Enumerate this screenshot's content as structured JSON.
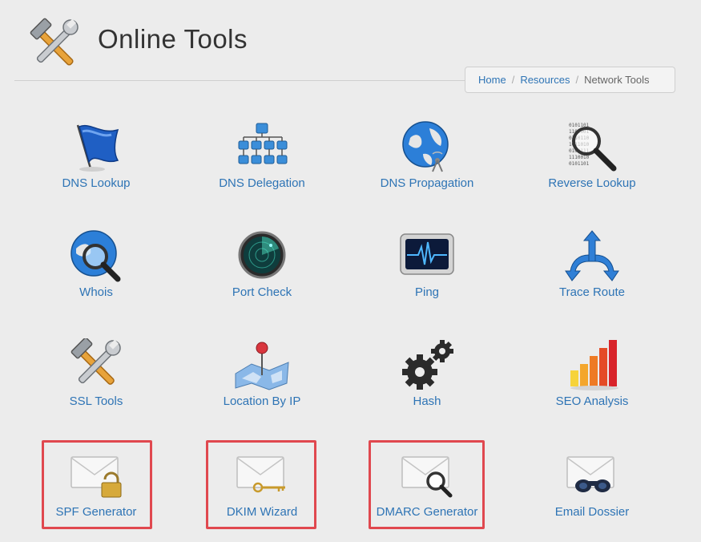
{
  "header": {
    "title": "Online Tools",
    "logo_icon": "tools-icon"
  },
  "breadcrumb": {
    "items": [
      "Home",
      "Resources"
    ],
    "current": "Network Tools"
  },
  "colors": {
    "link": "#2e74b5",
    "highlight": "#e0484f",
    "background": "#ececec"
  },
  "tools": [
    {
      "label": "DNS Lookup",
      "icon": "flag-icon"
    },
    {
      "label": "DNS Delegation",
      "icon": "hierarchy-icon"
    },
    {
      "label": "DNS Propagation",
      "icon": "globe-antenna-icon"
    },
    {
      "label": "Reverse Lookup",
      "icon": "magnifier-binary-icon"
    },
    {
      "label": "Whois",
      "icon": "globe-magnifier-icon"
    },
    {
      "label": "Port Check",
      "icon": "radar-icon"
    },
    {
      "label": "Ping",
      "icon": "monitor-pulse-icon"
    },
    {
      "label": "Trace Route",
      "icon": "route-arrows-icon"
    },
    {
      "label": "SSL Tools",
      "icon": "tools-icon"
    },
    {
      "label": "Location By IP",
      "icon": "map-pin-icon"
    },
    {
      "label": "Hash",
      "icon": "gears-icon"
    },
    {
      "label": "SEO Analysis",
      "icon": "bar-chart-icon"
    },
    {
      "label": "SPF Generator",
      "icon": "envelope-lock-icon"
    },
    {
      "label": "DKIM Wizard",
      "icon": "envelope-key-icon"
    },
    {
      "label": "DMARC Generator",
      "icon": "envelope-magnifier-icon"
    },
    {
      "label": "Email Dossier",
      "icon": "envelope-binoculars-icon"
    }
  ]
}
